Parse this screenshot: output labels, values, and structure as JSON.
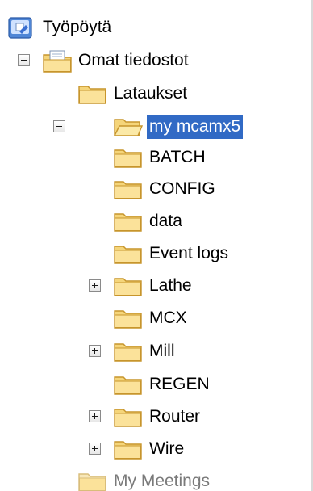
{
  "tree": {
    "items": [
      {
        "id": "desktop",
        "label": "Työpöytä",
        "icon": "desktop-icon",
        "expander": "none",
        "selected": false,
        "dim": false
      },
      {
        "id": "my-documents",
        "label": "Omat tiedostot",
        "icon": "documents-folder-icon",
        "expander": "minus",
        "selected": false,
        "dim": false
      },
      {
        "id": "downloads",
        "label": "Lataukset",
        "icon": "folder-icon",
        "expander": "none",
        "selected": false,
        "dim": false
      },
      {
        "id": "my-mcamx5",
        "label": "my mcamx5",
        "icon": "folder-open-icon",
        "expander": "minus",
        "selected": true,
        "dim": false
      },
      {
        "id": "batch",
        "label": "BATCH",
        "icon": "folder-icon",
        "expander": "none",
        "selected": false,
        "dim": false
      },
      {
        "id": "config",
        "label": "CONFIG",
        "icon": "folder-icon",
        "expander": "none",
        "selected": false,
        "dim": false
      },
      {
        "id": "data",
        "label": "data",
        "icon": "folder-icon",
        "expander": "none",
        "selected": false,
        "dim": false
      },
      {
        "id": "event-logs",
        "label": "Event logs",
        "icon": "folder-icon",
        "expander": "none",
        "selected": false,
        "dim": false
      },
      {
        "id": "lathe",
        "label": "Lathe",
        "icon": "folder-icon",
        "expander": "plus",
        "selected": false,
        "dim": false
      },
      {
        "id": "mcx",
        "label": "MCX",
        "icon": "folder-icon",
        "expander": "none",
        "selected": false,
        "dim": false
      },
      {
        "id": "mill",
        "label": "Mill",
        "icon": "folder-icon",
        "expander": "plus",
        "selected": false,
        "dim": false
      },
      {
        "id": "regen",
        "label": "REGEN",
        "icon": "folder-icon",
        "expander": "none",
        "selected": false,
        "dim": false
      },
      {
        "id": "router",
        "label": "Router",
        "icon": "folder-icon",
        "expander": "plus",
        "selected": false,
        "dim": false
      },
      {
        "id": "wire",
        "label": "Wire",
        "icon": "folder-icon",
        "expander": "plus",
        "selected": false,
        "dim": false
      },
      {
        "id": "my-meetings",
        "label": "My Meetings",
        "icon": "folder-icon",
        "expander": "none",
        "selected": false,
        "dim": true
      }
    ]
  },
  "colors": {
    "selection": "#316ac5",
    "folder_fill": "#f5d57a",
    "folder_edge": "#c7952c"
  }
}
